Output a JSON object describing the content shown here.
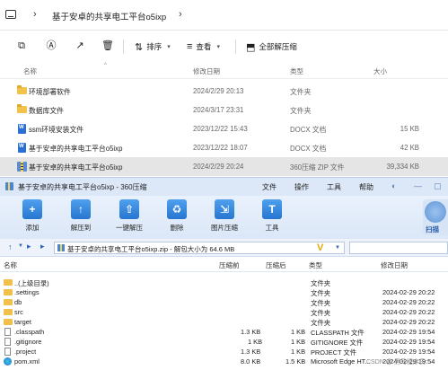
{
  "explorer": {
    "tab_path": "基于安卓的共享电工平台o5ixp",
    "toolbar": {
      "sort_label": "排序",
      "view_label": "查看",
      "extract_all_label": "全部解压缩"
    },
    "columns": {
      "name": "名称",
      "date": "修改日期",
      "type": "类型",
      "size": "大小"
    },
    "files": [
      {
        "name": "环境部署软件",
        "date": "2024/2/29 20:13",
        "type": "文件夹",
        "size": "",
        "icon": "folder-icon"
      },
      {
        "name": "数据库文件",
        "date": "2024/3/17 23:31",
        "type": "文件夹",
        "size": "",
        "icon": "folder-icon"
      },
      {
        "name": "ssm环境安装文件",
        "date": "2023/12/22 15:43",
        "type": "DOCX 文档",
        "size": "15 KB",
        "icon": "docx-icon"
      },
      {
        "name": "基于安卓的共享电工平台o5ixp",
        "date": "2023/12/22 18:07",
        "type": "DOCX 文档",
        "size": "42 KB",
        "icon": "docx-icon"
      },
      {
        "name": "基于安卓的共享电工平台o5ixp",
        "date": "2024/2/29 20:24",
        "type": "360压缩 ZIP 文件",
        "size": "39,334 KB",
        "icon": "zip-icon",
        "selected": true
      }
    ]
  },
  "zip": {
    "title": "基于安卓的共享电工平台o5ixp - 360压缩",
    "menu": [
      "文件",
      "操作",
      "工具",
      "帮助"
    ],
    "ribbon": [
      {
        "label": "添加",
        "icon": "add-icon"
      },
      {
        "label": "解压到",
        "icon": "extract-to-icon"
      },
      {
        "label": "一键解压",
        "icon": "one-click-extract-icon"
      },
      {
        "label": "删除",
        "icon": "delete-icon"
      },
      {
        "label": "图片压缩",
        "icon": "image-compress-icon"
      },
      {
        "label": "工具",
        "icon": "tools-icon"
      }
    ],
    "scan_label": "扫描",
    "address": "基于安卓的共享电工平台o5ixp.zip - 解包大小为 64.6 MB",
    "columns": {
      "name": "名称",
      "compressed": "压缩前",
      "after": "压缩后",
      "type": "类型",
      "date": "修改日期"
    },
    "rows": [
      {
        "name": "..(上级目录)",
        "before": "",
        "after": "",
        "type": "文件夹",
        "date": "",
        "icon": "folder-icon"
      },
      {
        "name": ".settings",
        "before": "",
        "after": "",
        "type": "文件夹",
        "date": "2024-02-29 20:22",
        "icon": "folder-icon"
      },
      {
        "name": "db",
        "before": "",
        "after": "",
        "type": "文件夹",
        "date": "2024-02-29 20:22",
        "icon": "folder-icon"
      },
      {
        "name": "src",
        "before": "",
        "after": "",
        "type": "文件夹",
        "date": "2024-02-29 20:22",
        "icon": "folder-icon"
      },
      {
        "name": "target",
        "before": "",
        "after": "",
        "type": "文件夹",
        "date": "2024-02-29 20:22",
        "icon": "folder-icon"
      },
      {
        "name": ".classpath",
        "before": "1.3 KB",
        "after": "1 KB",
        "type": "CLASSPATH 文件",
        "date": "2024-02-29 19:54",
        "icon": "file-icon"
      },
      {
        "name": ".gitignore",
        "before": "1 KB",
        "after": "1 KB",
        "type": "GITIGNORE 文件",
        "date": "2024-02-29 19:54",
        "icon": "file-icon"
      },
      {
        "name": ".project",
        "before": "1.3 KB",
        "after": "1 KB",
        "type": "PROJECT 文件",
        "date": "2024-02-29 19:54",
        "icon": "file-icon"
      },
      {
        "name": "pom.xml",
        "before": "8.0 KB",
        "after": "1.5 KB",
        "type": "Microsoft Edge HT...",
        "date": "2024-02-29 19:54",
        "icon": "edge-icon"
      }
    ]
  },
  "watermark": "CSDN @ 黑马程序员"
}
